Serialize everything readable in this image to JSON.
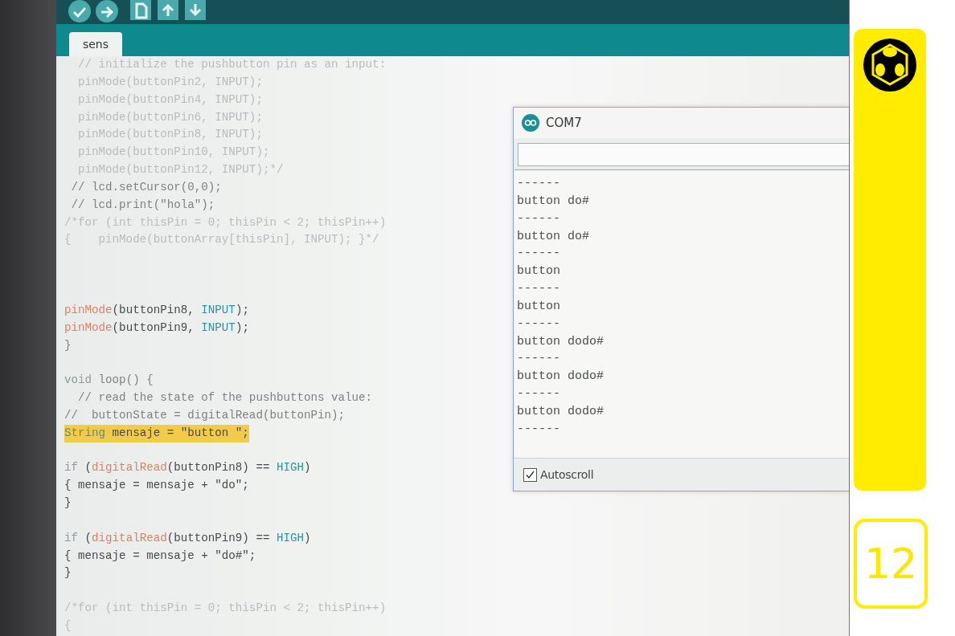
{
  "tabs": [
    {
      "label": "sens",
      "selected": true
    }
  ],
  "editor": {
    "lines": [
      {
        "kind": "code",
        "segments": [
          {
            "text": "  // initialize the pushbutton pin as an input:",
            "kind": "faded"
          }
        ]
      },
      {
        "kind": "code",
        "segments": [
          {
            "text": "  pinMode(buttonPin2, INPUT);",
            "kind": "faded"
          }
        ]
      },
      {
        "kind": "code",
        "segments": [
          {
            "text": "  pinMode(buttonPin4, INPUT);",
            "kind": "faded"
          }
        ]
      },
      {
        "kind": "code",
        "segments": [
          {
            "text": "  pinMode(buttonPin6, INPUT);",
            "kind": "faded"
          }
        ]
      },
      {
        "kind": "code",
        "segments": [
          {
            "text": "  pinMode(buttonPin8, INPUT);",
            "kind": "faded"
          }
        ]
      },
      {
        "kind": "code",
        "segments": [
          {
            "text": "  pinMode(buttonPin10, INPUT);",
            "kind": "faded"
          }
        ]
      },
      {
        "kind": "code",
        "segments": [
          {
            "text": "  pinMode(buttonPin12, INPUT);*/",
            "kind": "faded"
          }
        ]
      },
      {
        "kind": "code",
        "segments": [
          {
            "text": " // lcd.setCursor(0,0);",
            "kind": "comment"
          }
        ]
      },
      {
        "kind": "code",
        "segments": [
          {
            "text": " // lcd.print(\"hola\");",
            "kind": "comment"
          }
        ]
      },
      {
        "kind": "code",
        "segments": [
          {
            "text": "/*for (int thisPin = 0; thisPin < 2; thisPin++)",
            "kind": "faded"
          }
        ]
      },
      {
        "kind": "code",
        "segments": [
          {
            "text": "{    pinMode(buttonArray[thisPin], INPUT); }*/",
            "kind": "faded"
          }
        ]
      },
      {
        "kind": "blank"
      },
      {
        "kind": "blank"
      },
      {
        "kind": "blank"
      },
      {
        "kind": "code",
        "segments": [
          {
            "text": "pinMode",
            "kind": "function"
          },
          {
            "text": "(buttonPin8, ",
            "kind": "plain"
          },
          {
            "text": "INPUT",
            "kind": "constant"
          },
          {
            "text": ");",
            "kind": "plain"
          }
        ]
      },
      {
        "kind": "code",
        "segments": [
          {
            "text": "pinMode",
            "kind": "function"
          },
          {
            "text": "(buttonPin9, ",
            "kind": "plain"
          },
          {
            "text": "INPUT",
            "kind": "constant"
          },
          {
            "text": ");",
            "kind": "plain"
          }
        ]
      },
      {
        "kind": "code",
        "segments": [
          {
            "text": "}",
            "kind": "comment"
          }
        ]
      },
      {
        "kind": "blank"
      },
      {
        "kind": "code",
        "segments": [
          {
            "text": "void",
            "kind": "keyword"
          },
          {
            "text": " loop() {",
            "kind": "comment"
          }
        ]
      },
      {
        "kind": "code",
        "segments": [
          {
            "text": "  // read the state of the pushbuttons value:",
            "kind": "comment"
          }
        ]
      },
      {
        "kind": "code",
        "segments": [
          {
            "text": "//  buttonState = digitalRead(buttonPin);",
            "kind": "comment"
          }
        ]
      },
      {
        "kind": "code",
        "highlighted": true,
        "segments": [
          {
            "text": "String",
            "kind": "keyword"
          },
          {
            "text": " mensaje = \"button \";",
            "kind": "plain"
          }
        ]
      },
      {
        "kind": "blank"
      },
      {
        "kind": "code",
        "segments": [
          {
            "text": "if",
            "kind": "keyword"
          },
          {
            "text": " (",
            "kind": "plain"
          },
          {
            "text": "digitalRead",
            "kind": "function"
          },
          {
            "text": "(buttonPin8) == ",
            "kind": "plain"
          },
          {
            "text": "HIGH",
            "kind": "constant"
          },
          {
            "text": ")",
            "kind": "plain"
          }
        ]
      },
      {
        "kind": "code",
        "segments": [
          {
            "text": "{ mensaje = mensaje + \"do\";",
            "kind": "plain"
          }
        ]
      },
      {
        "kind": "code",
        "segments": [
          {
            "text": "}",
            "kind": "plain"
          }
        ]
      },
      {
        "kind": "blank"
      },
      {
        "kind": "code",
        "segments": [
          {
            "text": "if",
            "kind": "keyword"
          },
          {
            "text": " (",
            "kind": "plain"
          },
          {
            "text": "digitalRead",
            "kind": "function"
          },
          {
            "text": "(buttonPin9) == ",
            "kind": "plain"
          },
          {
            "text": "HIGH",
            "kind": "constant"
          },
          {
            "text": ")",
            "kind": "plain"
          }
        ]
      },
      {
        "kind": "code",
        "segments": [
          {
            "text": "{ mensaje = mensaje + \"do#\";",
            "kind": "plain"
          }
        ]
      },
      {
        "kind": "code",
        "segments": [
          {
            "text": "}",
            "kind": "plain"
          }
        ]
      },
      {
        "kind": "blank"
      },
      {
        "kind": "code",
        "segments": [
          {
            "text": "/*for (int thisPin = 0; thisPin < 2; thisPin++)",
            "kind": "faded"
          }
        ]
      },
      {
        "kind": "code",
        "segments": [
          {
            "text": "{",
            "kind": "faded"
          }
        ]
      }
    ]
  },
  "serial_monitor": {
    "title": "COM7",
    "output": [
      "------",
      "button do#",
      "------",
      "button do#",
      "------",
      "button",
      "------",
      "button",
      "------",
      "button dodo#",
      "------",
      "button dodo#",
      "------",
      "button dodo#",
      "------"
    ],
    "autoscroll": {
      "label": "Autoscroll",
      "checked": true
    }
  },
  "side_panel": {
    "page_number": "12"
  }
}
